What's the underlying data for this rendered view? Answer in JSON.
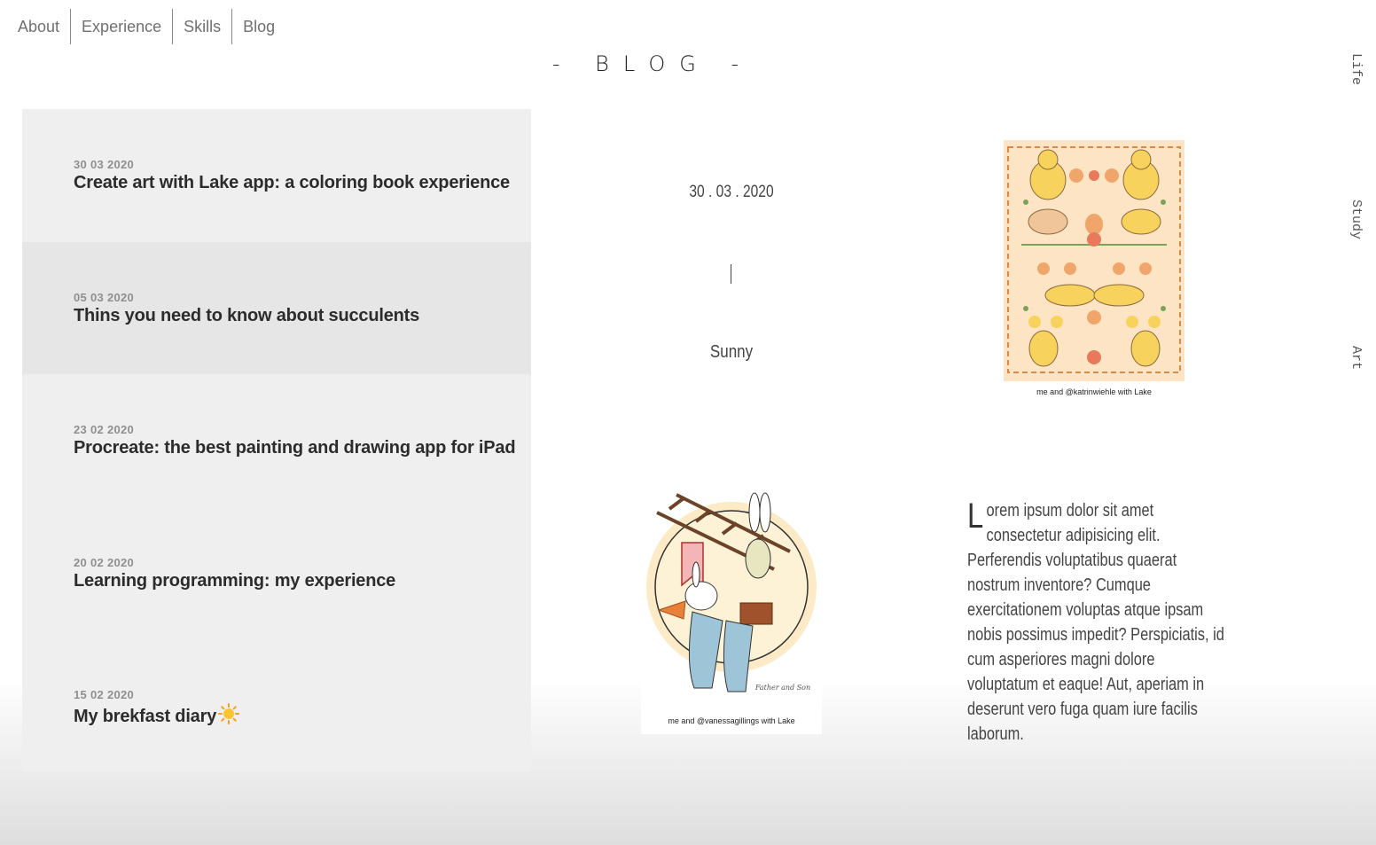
{
  "nav": {
    "items": [
      "About",
      "Experience",
      "Skills",
      "Blog"
    ]
  },
  "header": {
    "title": "- BLOG -"
  },
  "side_tabs": [
    "Life",
    "Study",
    "Art"
  ],
  "posts": [
    {
      "date": "30 03 2020",
      "title": "Create art with Lake app: a coloring book experience"
    },
    {
      "date": "05 03 2020",
      "title": "Thins you need to know about succulents"
    },
    {
      "date": "23 02 2020",
      "title": "Procreate: the best painting and drawing app for iPad"
    },
    {
      "date": "20 02 2020",
      "title": "Learning programming: my experience"
    },
    {
      "date": "15 02 2020",
      "title": "My brekfast diary",
      "icon": "sun-emoji-icon"
    }
  ],
  "detail": {
    "date": "30 . 03 . 2020",
    "weather": "Sunny",
    "image1_caption": "me and @katrinwiehle with Lake",
    "image2_caption": "me and @vanessagillings with Lake",
    "image2_signature": "Father and Son",
    "body_initial": "L",
    "body_rest": "orem ipsum dolor sit amet consectetur adipisicing elit. Perferendis voluptatibus quaerat nostrum inventore? Cumque exercitationem voluptas atque ipsam nobis possimus impedit? Perspiciatis, id cum asperiores magni dolore voluptatum et eaque! Aut, aperiam in deserunt vero fuga quam iure facilis laborum."
  },
  "colors": {
    "list_bg": "#efefef",
    "list_active_bg": "#e6e6e6",
    "art_bg": "#fde4c4",
    "cat_yellow": "#f7d25c",
    "cat_orange": "#f0a66b"
  }
}
